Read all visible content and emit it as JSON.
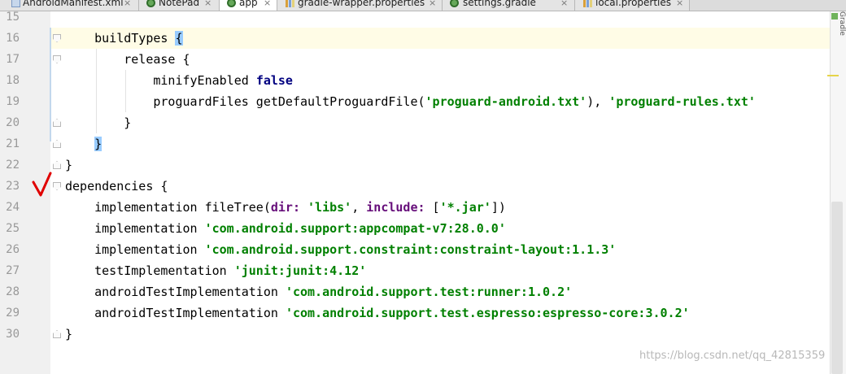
{
  "tabs": [
    {
      "label": "AndroidManifest.xml",
      "icon": "xml-file-icon",
      "active": false
    },
    {
      "label": "NotePad",
      "icon": "module-icon",
      "active": false
    },
    {
      "label": "app",
      "icon": "gradle-module-icon",
      "active": true
    },
    {
      "label": "gradle-wrapper.properties",
      "icon": "properties-file-icon",
      "active": false
    },
    {
      "label": "settings.gradle",
      "icon": "gradle-file-icon",
      "active": false
    },
    {
      "label": "local.properties",
      "icon": "properties-file-icon",
      "active": false
    }
  ],
  "close_glyph": "×",
  "right_label": "Gradle",
  "lines": [
    {
      "num": "15",
      "code": ""
    },
    {
      "num": "16",
      "code": "    buildTypes {"
    },
    {
      "num": "17",
      "code": "        release {"
    },
    {
      "num": "18",
      "code": "            minifyEnabled false"
    },
    {
      "num": "19",
      "code": "            proguardFiles getDefaultProguardFile('proguard-android.txt'), 'proguard-rules.txt'"
    },
    {
      "num": "20",
      "code": "        }"
    },
    {
      "num": "21",
      "code": "    }"
    },
    {
      "num": "22",
      "code": "}"
    },
    {
      "num": "23",
      "code": "dependencies {"
    },
    {
      "num": "24",
      "code": "    implementation fileTree(dir: 'libs', include: ['*.jar'])"
    },
    {
      "num": "25",
      "code": "    implementation 'com.android.support:appcompat-v7:28.0.0'"
    },
    {
      "num": "26",
      "code": "    implementation 'com.android.support.constraint:constraint-layout:1.1.3'"
    },
    {
      "num": "27",
      "code": "    testImplementation 'junit:junit:4.12'"
    },
    {
      "num": "28",
      "code": "    androidTestImplementation 'com.android.support.test:runner:1.0.2'"
    },
    {
      "num": "29",
      "code": "    androidTestImplementation 'com.android.support.test.espresso:espresso-core:3.0.2'"
    },
    {
      "num": "30",
      "code": "}"
    }
  ],
  "watermark": "https://blog.csdn.net/qq_42815359",
  "colors": {
    "keyword": "#000080",
    "string": "#008000",
    "param": "#660e7a",
    "brace_highlight": "#99ccff",
    "current_line": "#fffce6",
    "check_mark": "#e00000"
  }
}
